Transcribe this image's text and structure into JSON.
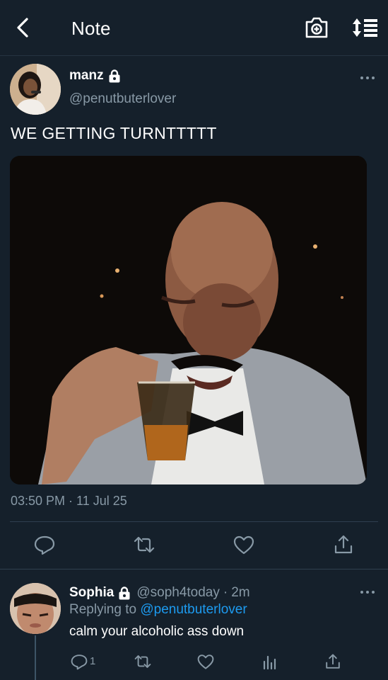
{
  "header": {
    "title": "Note",
    "back_icon": "chevron-left-icon",
    "camera_icon": "camera-icon",
    "sort_icon": "sort-list-icon"
  },
  "tweet": {
    "display_name": "manz",
    "handle": "@penutbuterlover",
    "text": "WE GETTING TURNTTTTT",
    "timestamp": "03:50 PM · 11 Jul 25",
    "media": "photo of a man in a tuxedo crying while holding a shot glass of whiskey",
    "actions": [
      "reply-icon",
      "retweet-icon",
      "like-icon",
      "share-icon"
    ]
  },
  "reply": {
    "display_name": "Sophia",
    "handle": "@soph4today",
    "separator": "·",
    "time": "2m",
    "replying_prefix": "Replying to",
    "replying_to": "@penutbuterlover",
    "text": "calm your alcoholic ass down",
    "reply_count": "1",
    "actions": [
      "reply-icon",
      "retweet-icon",
      "like-icon",
      "analytics-icon",
      "share-icon"
    ]
  },
  "colors": {
    "background": "#15202b",
    "secondary_text": "#8899a6",
    "link": "#1d9bf0",
    "divider": "#2f3f4f"
  }
}
